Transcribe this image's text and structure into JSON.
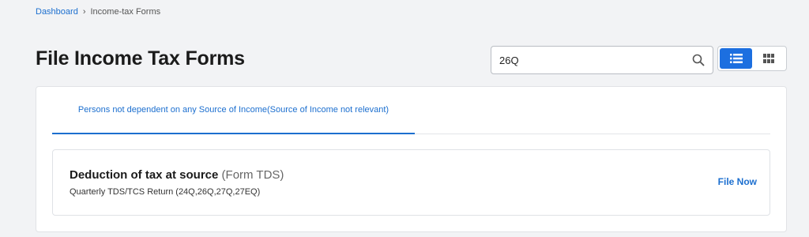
{
  "breadcrumb": {
    "home": "Dashboard",
    "separator": "›",
    "current": "Income-tax Forms"
  },
  "page": {
    "title": "File Income Tax Forms"
  },
  "search": {
    "value": "26Q",
    "icon": "search-icon"
  },
  "view_toggle": {
    "options": [
      "list-view",
      "grid-view"
    ],
    "selected": "list-view"
  },
  "tabs": [
    {
      "label": "Persons not dependent on any Source of Income(Source of Income not relevant)",
      "active": true
    }
  ],
  "forms": [
    {
      "title": "Deduction of tax at source",
      "code": "(Form TDS)",
      "description": "Quarterly TDS/TCS Return (24Q,26Q,27Q,27EQ)",
      "action": "File Now"
    }
  ],
  "colors": {
    "accent": "#1c6fcf",
    "active_toggle": "#1c6fe0",
    "background": "#f2f3f5"
  }
}
